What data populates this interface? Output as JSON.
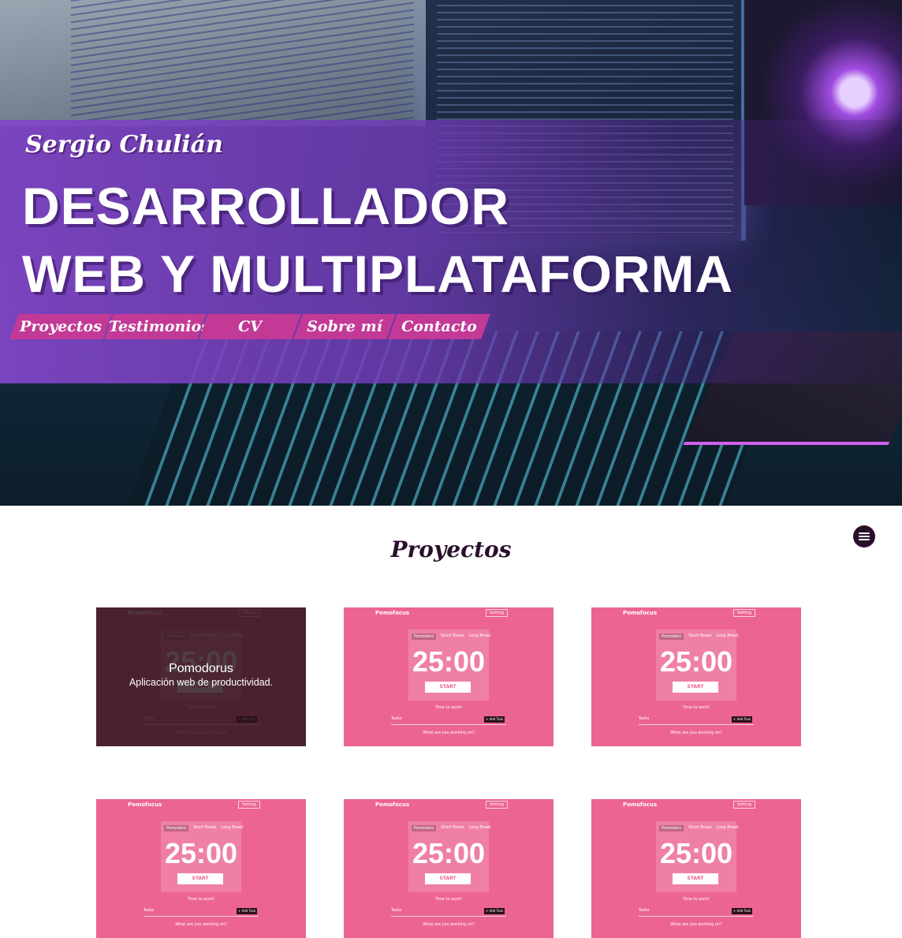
{
  "hero": {
    "brand": "Sergio Chulián",
    "headline_line1": "DESARROLLADOR",
    "headline_line2": "WEB Y MULTIPLATAFORMA",
    "nav": [
      "Proyectos",
      "Testimonios",
      "CV",
      "Sobre mí",
      "Contacto"
    ]
  },
  "projects": {
    "title": "Proyectos",
    "menu_icon": "hamburger-icon",
    "featured": {
      "title": "Pomodorus",
      "description": "Aplicación web de productividad."
    },
    "card_screenshot": {
      "logo": "Pomofocus",
      "setting": "Setting",
      "tabs": [
        "Pomodoro",
        "Short Break",
        "Long Break"
      ],
      "time": "25:00",
      "start": "START",
      "hint": "Time to work!",
      "task_label": "Tasks",
      "add_task": "+ Add Task",
      "question": "What are you working on?"
    }
  },
  "colors": {
    "accent": "#c23a95",
    "hero_band": "#8246c8",
    "card_bg": "#ec6590",
    "title": "#2a0f2c"
  }
}
